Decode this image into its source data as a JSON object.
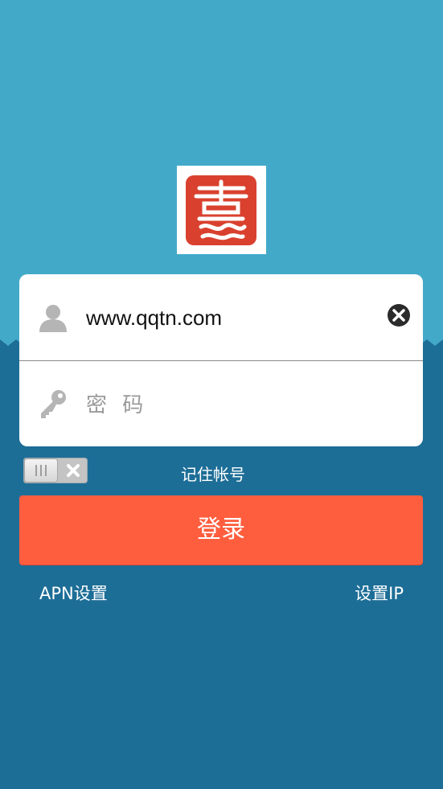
{
  "login_form": {
    "username_value": "www.qqtn.com",
    "password_placeholder": "密 码"
  },
  "remember": {
    "label": "记住帐号",
    "checked": false
  },
  "login_button": {
    "label": "登录"
  },
  "links": {
    "apn_settings": "APN设置",
    "set_ip": "设置IP"
  },
  "colors": {
    "sky": "#43a9c9",
    "sea": "#1d6e97",
    "logo_red": "#d9412e",
    "button": "#ff5e3e"
  },
  "icons": [
    "user-icon",
    "key-icon",
    "clear-icon",
    "toggle-x-icon",
    "app-logo"
  ]
}
